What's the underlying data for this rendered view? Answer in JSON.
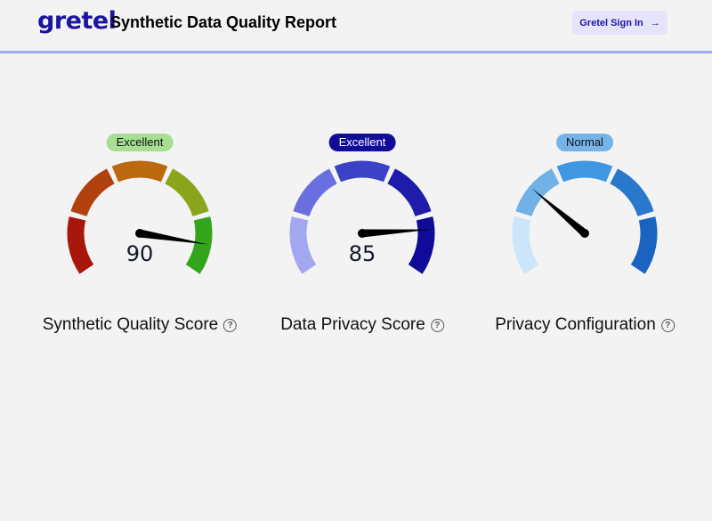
{
  "header": {
    "logo": "gretel",
    "title": "Synthetic Data Quality Report",
    "sign_in": "Gretel Sign In",
    "sign_in_icon": "arrow-right-icon"
  },
  "gauges": [
    {
      "label": "Synthetic Quality Score",
      "badge": "Excellent",
      "badge_bg": "#a6df94",
      "badge_fg": "#111111",
      "value": 90,
      "show_value": true,
      "needle_fraction": 0.9,
      "colors": [
        "#a8170b",
        "#b2420d",
        "#ba690f",
        "#8ba51b",
        "#33a51a"
      ]
    },
    {
      "label": "Data Privacy Score",
      "badge": "Excellent",
      "badge_bg": "#100c98",
      "badge_fg": "#ffffff",
      "value": 85,
      "show_value": true,
      "needle_fraction": 0.85,
      "colors": [
        "#a2a7ef",
        "#6a6fdf",
        "#3c42c6",
        "#1f1bab",
        "#0f0b98"
      ]
    },
    {
      "label": "Privacy Configuration",
      "badge": "Normal",
      "badge_bg": "#74b4e8",
      "badge_fg": "#111111",
      "show_value": false,
      "needle_fraction": 0.3,
      "colors": [
        "#cce5f8",
        "#70b2e6",
        "#3e97e0",
        "#2878cc",
        "#1a63c1"
      ]
    }
  ]
}
